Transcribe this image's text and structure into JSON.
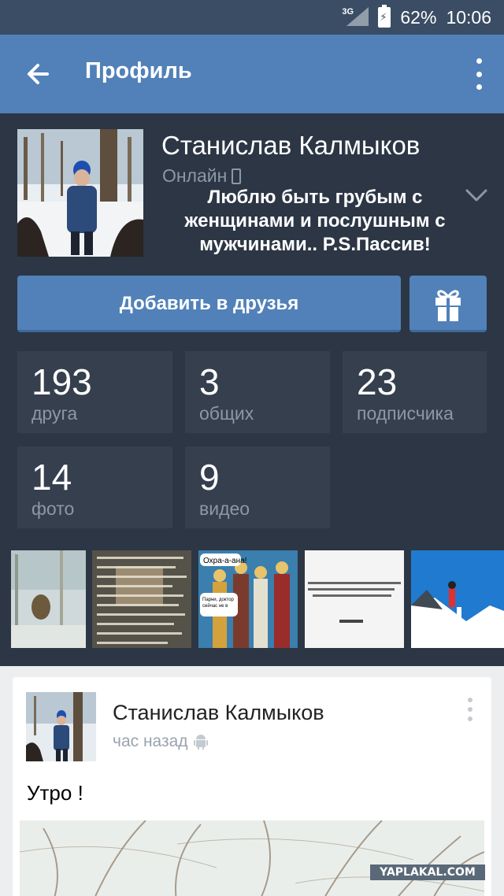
{
  "status_bar": {
    "network": "3G",
    "battery": "62%",
    "time": "10:06",
    "icons": [
      "signal-icon",
      "battery-charging-icon"
    ]
  },
  "app_bar": {
    "title": "Профиль",
    "icons": [
      "back-arrow-icon",
      "more-vertical-icon"
    ]
  },
  "profile": {
    "name": "Станислав Калмыков",
    "online_status": "Онлайн",
    "status_text": "Люблю быть грубым с женщинами и послушным с мужчинами.. P.S.Пассив!",
    "add_friend_label": "Добавить в друзья",
    "icons": [
      "phone-icon",
      "chevron-down-icon",
      "gift-icon"
    ]
  },
  "counters": [
    {
      "value": "193",
      "label": "друга"
    },
    {
      "value": "3",
      "label": "общих"
    },
    {
      "value": "23",
      "label": "подписчика"
    },
    {
      "value": "14",
      "label": "фото"
    },
    {
      "value": "9",
      "label": "видео"
    }
  ],
  "photo_strip": {
    "captions": [
      "Охра-а-ана!",
      "Парни, доктор сейчас не в настроении для шуток"
    ]
  },
  "post": {
    "author": "Станислав Калмыков",
    "time": "час назад",
    "text": "Утро !",
    "icons": [
      "android-icon",
      "more-vertical-icon"
    ]
  },
  "watermark": "YAPLAKAL.COM",
  "colors": {
    "status_bar": "#3a4d64",
    "app_bar": "#5181b8",
    "profile_bg": "#2c3645",
    "counter_bg": "#353f4e",
    "accent": "#5181b8"
  }
}
